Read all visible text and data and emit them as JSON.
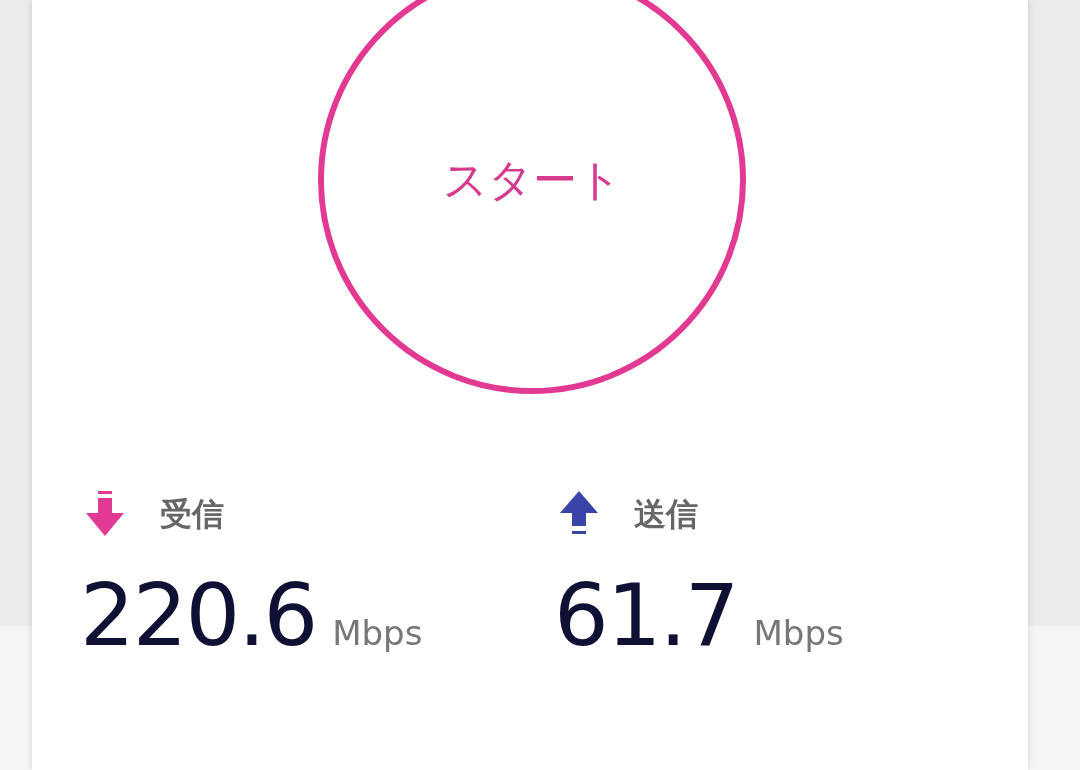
{
  "start_button": {
    "label": "スタート"
  },
  "metrics": [
    {
      "kind": "download",
      "label": "受信",
      "value": "220.6",
      "unit": "Mbps"
    },
    {
      "kind": "upload",
      "label": "送信",
      "value": "61.7",
      "unit": "Mbps"
    }
  ]
}
